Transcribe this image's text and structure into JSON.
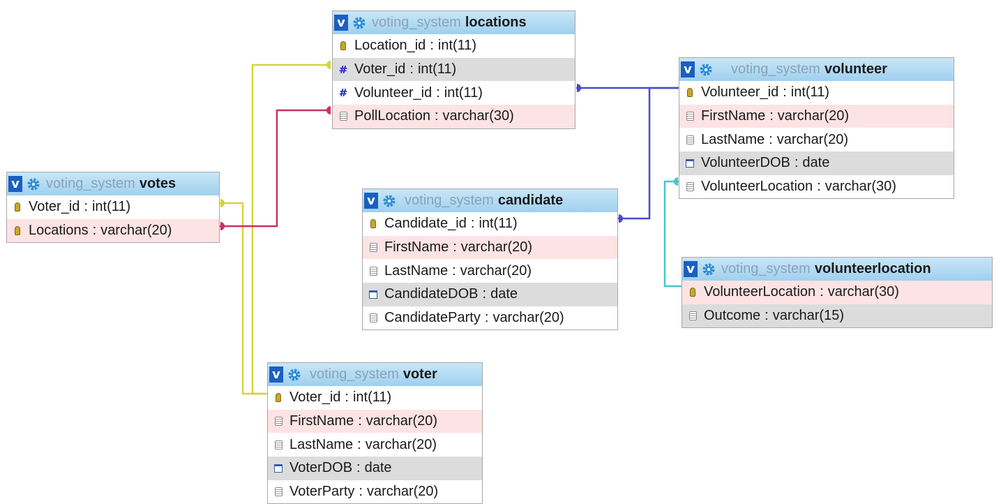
{
  "database": "voting_system",
  "tables": [
    {
      "name": "locations",
      "columns": [
        {
          "name": "Location_id",
          "type": "int(11)",
          "icon": "primary-key-icon",
          "highlight": "none"
        },
        {
          "name": "Voter_id",
          "type": "int(11)",
          "icon": "numeric-icon",
          "highlight": "gray"
        },
        {
          "name": "Volunteer_id",
          "type": "int(11)",
          "icon": "numeric-icon",
          "highlight": "none"
        },
        {
          "name": "PollLocation",
          "type": "varchar(30)",
          "icon": "text-column-icon",
          "highlight": "pink"
        }
      ]
    },
    {
      "name": "volunteer",
      "columns": [
        {
          "name": "Volunteer_id",
          "type": "int(11)",
          "icon": "primary-key-icon",
          "highlight": "none"
        },
        {
          "name": "FirstName",
          "type": "varchar(20)",
          "icon": "text-column-icon",
          "highlight": "pink"
        },
        {
          "name": "LastName",
          "type": "varchar(20)",
          "icon": "text-column-icon",
          "highlight": "none"
        },
        {
          "name": "VolunteerDOB",
          "type": "date",
          "icon": "date-column-icon",
          "highlight": "gray"
        },
        {
          "name": "VolunteerLocation",
          "type": "varchar(30)",
          "icon": "text-column-icon",
          "highlight": "none"
        }
      ]
    },
    {
      "name": "votes",
      "columns": [
        {
          "name": "Voter_id",
          "type": "int(11)",
          "icon": "primary-key-icon",
          "highlight": "none"
        },
        {
          "name": "Locations",
          "type": "varchar(20)",
          "icon": "primary-key-icon",
          "highlight": "pink"
        }
      ]
    },
    {
      "name": "candidate",
      "columns": [
        {
          "name": "Candidate_id",
          "type": "int(11)",
          "icon": "primary-key-icon",
          "highlight": "none"
        },
        {
          "name": "FirstName",
          "type": "varchar(20)",
          "icon": "text-column-icon",
          "highlight": "pink"
        },
        {
          "name": "LastName",
          "type": "varchar(20)",
          "icon": "text-column-icon",
          "highlight": "none"
        },
        {
          "name": "CandidateDOB",
          "type": "date",
          "icon": "date-column-icon",
          "highlight": "gray"
        },
        {
          "name": "CandidateParty",
          "type": "varchar(20)",
          "icon": "text-column-icon",
          "highlight": "none"
        }
      ]
    },
    {
      "name": "volunteerlocation",
      "columns": [
        {
          "name": "VolunteerLocation",
          "type": "varchar(30)",
          "icon": "primary-key-icon",
          "highlight": "pink"
        },
        {
          "name": "Outcome",
          "type": "varchar(15)",
          "icon": "text-column-icon",
          "highlight": "gray"
        }
      ]
    },
    {
      "name": "voter",
      "columns": [
        {
          "name": "Voter_id",
          "type": "int(11)",
          "icon": "primary-key-icon",
          "highlight": "none"
        },
        {
          "name": "FirstName",
          "type": "varchar(20)",
          "icon": "text-column-icon",
          "highlight": "pink"
        },
        {
          "name": "LastName",
          "type": "varchar(20)",
          "icon": "text-column-icon",
          "highlight": "none"
        },
        {
          "name": "VoterDOB",
          "type": "date",
          "icon": "date-column-icon",
          "highlight": "gray"
        },
        {
          "name": "VoterParty",
          "type": "varchar(20)",
          "icon": "text-column-icon",
          "highlight": "none"
        }
      ]
    }
  ],
  "relations": [
    {
      "from": "locations.Voter_id",
      "to": "votes.Voter_id",
      "color": "#d4d43a"
    },
    {
      "from": "locations.PollLocation",
      "to": "votes.Locations",
      "color": "#c8306a"
    },
    {
      "from": "votes.Voter_id",
      "to": "voter.Voter_id",
      "color": "#d4d43a"
    },
    {
      "from": "locations.Volunteer_id",
      "to": "volunteer.Volunteer_id",
      "color": "#4a4acc"
    },
    {
      "from": "candidate.Candidate_id",
      "to": "volunteer.Volunteer_id",
      "color": "#4a4acc"
    },
    {
      "from": "volunteer.VolunteerLocation",
      "to": "volunteerlocation.VolunteerLocation",
      "color": "#40c8c8"
    }
  ],
  "colors": {
    "header_gradient_top": "#c9e6f7",
    "header_gradient_bottom": "#9fd0ef",
    "row_pink": "#fde3e3",
    "row_gray": "#dcdcdc",
    "v_button": "#1a5fc2"
  }
}
